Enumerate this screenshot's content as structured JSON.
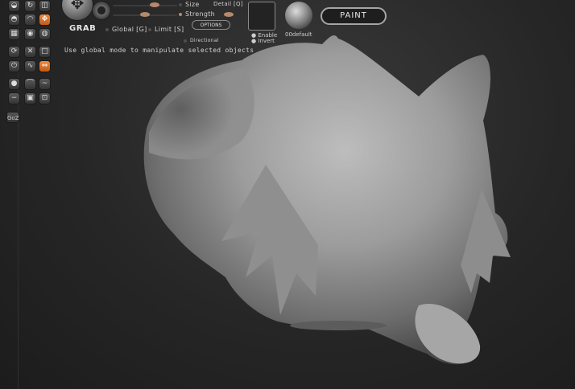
{
  "tool": {
    "name": "GRAB"
  },
  "options": {
    "global_label": "Global [G]",
    "limit_label": "Limit [S]",
    "directional_label": "Directional",
    "hint": "Use global mode to manipulate selected objects",
    "size_label": "Size",
    "strength_label": "Strength",
    "detail_label": "Detail [Q]",
    "options_button": "OPTIONS",
    "enable_label": "Enable",
    "invert_label": "Invert",
    "material_name": "00default",
    "paint_button": "PAINT"
  },
  "toolbar": {
    "goz_label": "GoZ"
  },
  "sliders": {
    "size": 0.65,
    "strength": 0.5
  },
  "colors": {
    "accent": "#e8782c",
    "background": "#2a2a2a",
    "model": "#a8a8a8"
  }
}
